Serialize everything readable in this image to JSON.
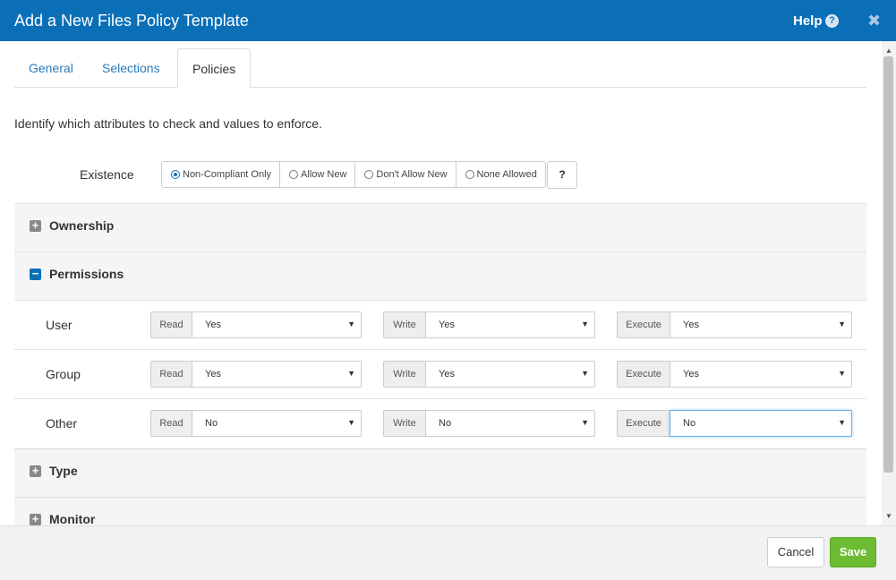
{
  "dialog": {
    "title": "Add a New Files Policy Template",
    "help_label": "Help",
    "help_icon": "?",
    "close_icon": "✖"
  },
  "tabs": [
    {
      "label": "General",
      "active": false
    },
    {
      "label": "Selections",
      "active": false
    },
    {
      "label": "Policies",
      "active": true
    }
  ],
  "intro_text": "Identify which attributes to check and values to enforce.",
  "existence": {
    "label": "Existence",
    "options": [
      "Non-Compliant Only",
      "Allow New",
      "Don't Allow New",
      "None Allowed"
    ],
    "selected": "Non-Compliant Only",
    "help_button": "?"
  },
  "sections": {
    "ownership": {
      "title": "Ownership",
      "expanded": false,
      "toggle_symbol": "+"
    },
    "permissions": {
      "title": "Permissions",
      "expanded": true,
      "toggle_symbol": "−"
    },
    "type": {
      "title": "Type",
      "expanded": false,
      "toggle_symbol": "+"
    },
    "monitor": {
      "title": "Monitor",
      "expanded": false,
      "toggle_symbol": "+"
    }
  },
  "permissions": {
    "rows": [
      {
        "label": "User",
        "read_label": "Read",
        "read": "Yes",
        "write_label": "Write",
        "write": "Yes",
        "execute_label": "Execute",
        "execute": "Yes"
      },
      {
        "label": "Group",
        "read_label": "Read",
        "read": "Yes",
        "write_label": "Write",
        "write": "Yes",
        "execute_label": "Execute",
        "execute": "Yes"
      },
      {
        "label": "Other",
        "read_label": "Read",
        "read": "No",
        "write_label": "Write",
        "write": "No",
        "execute_label": "Execute",
        "execute": "No"
      }
    ]
  },
  "footer": {
    "cancel_label": "Cancel",
    "save_label": "Save"
  },
  "colors": {
    "header_bg": "#0b6fb8",
    "save_bg": "#6cbb32",
    "link": "#2e7ab8"
  }
}
